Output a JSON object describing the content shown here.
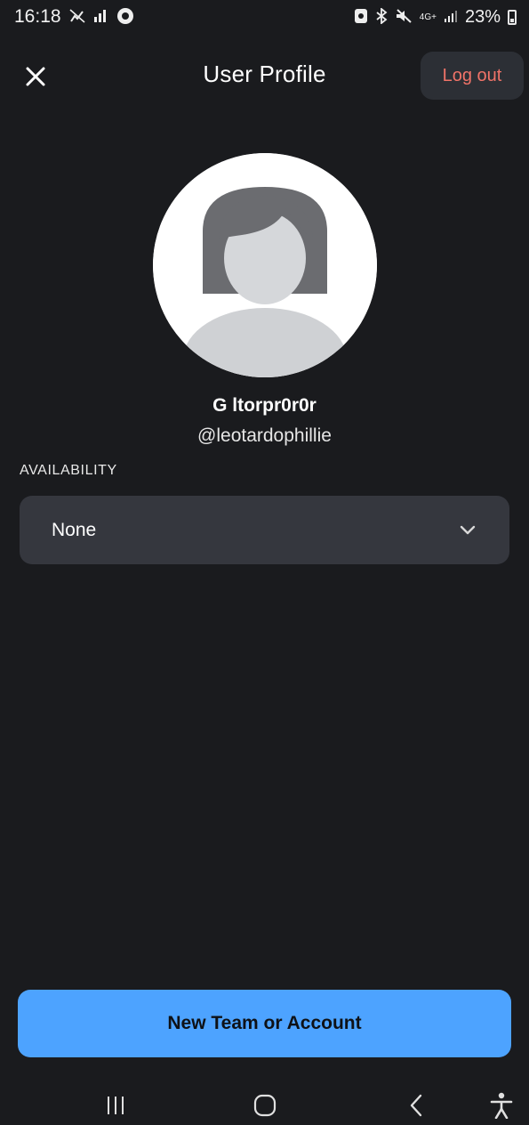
{
  "status_bar": {
    "time": "16:18",
    "battery": "23%",
    "network": "4G+"
  },
  "header": {
    "title": "User Profile",
    "logout_label": "Log out"
  },
  "profile": {
    "name": "G ltorpr0r0r",
    "handle": "@leotardophillie"
  },
  "availability": {
    "label": "AVAILABILITY",
    "selected": "None"
  },
  "actions": {
    "new_team_label": "New Team or Account"
  },
  "colors": {
    "background": "#1a1b1e",
    "accent": "#4da3ff",
    "logout": "#f07368",
    "field": "#35373e"
  }
}
